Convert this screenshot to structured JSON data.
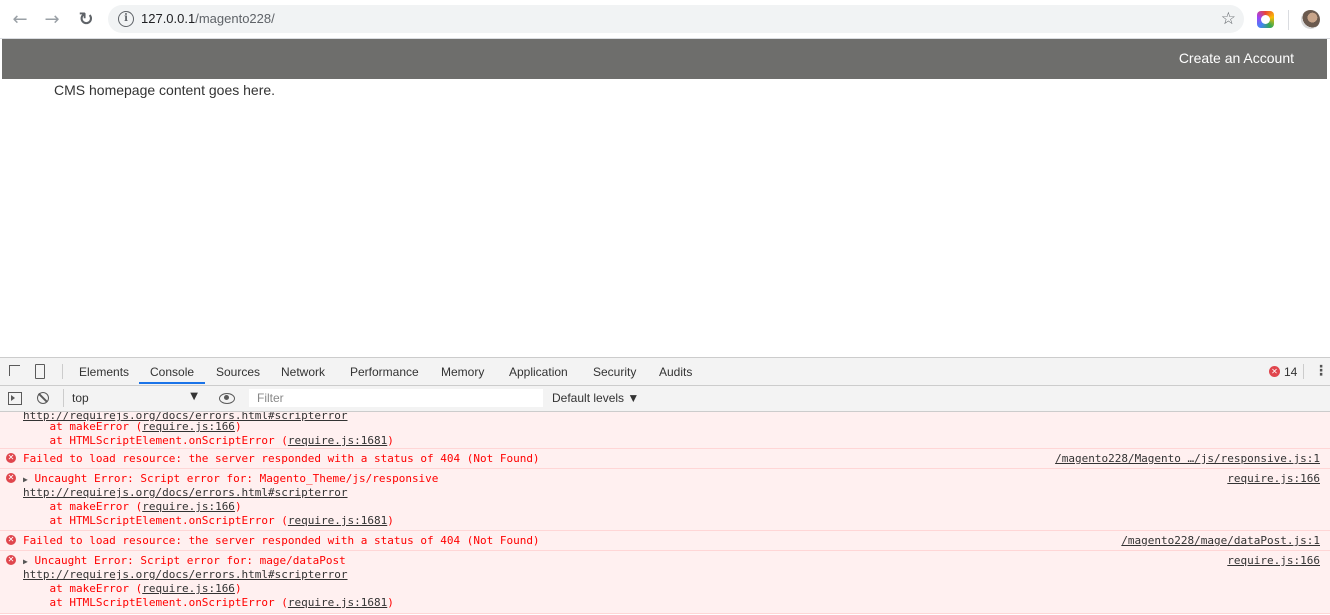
{
  "browser": {
    "url_host": "127.0.0.1",
    "url_path": "/magento228/",
    "back_glyph": "←",
    "forward_glyph": "→",
    "reload_glyph": "↻",
    "info_glyph": "i",
    "star_glyph": "☆"
  },
  "page": {
    "header_link": "Create an Account",
    "content": "CMS homepage content goes here."
  },
  "devtools": {
    "tabs": [
      "Elements",
      "Console",
      "Sources",
      "Network",
      "Performance",
      "Memory",
      "Application",
      "Security",
      "Audits"
    ],
    "active_tab": "Console",
    "error_count": "14",
    "kebab_glyph": "⋮",
    "context_value": "top",
    "caret_glyph": "▼",
    "filter_placeholder": "Filter",
    "levels_label": "Default levels ▼",
    "messages": [
      {
        "lines": [
          "http://requirejs.org/docs/errors.html#scripterror",
          "    at makeError (",
          "require.js:166",
          ")",
          "    at HTMLScriptElement.onScriptError (",
          "require.js:1681",
          ")"
        ]
      }
    ],
    "console": {
      "top_fragment_link": "http://requirejs.org/docs/errors.html#scripterror",
      "at": "    at ",
      "make_error": "makeError (",
      "script_error": "HTMLScriptElement.onScriptError (",
      "close_paren": ")",
      "require_166": "require.js:166",
      "require_1681": "require.js:1681",
      "fail_text": "Failed to load resource: the server responded with a status of 404 (Not Found)",
      "fail1_src": "/magento228/Magento …/js/responsive.js:1",
      "uncaught1": "Uncaught Error: Script error for: Magento_Theme/js/responsive",
      "uncaught1_src": "require.js:166",
      "scripterror_link": "http://requirejs.org/docs/errors.html#scripterror",
      "fail2_src": "/magento228/mage/dataPost.js:1",
      "uncaught2": "Uncaught Error: Script error for: mage/dataPost",
      "uncaught2_src": "require.js:166",
      "error_glyph": "✕",
      "expand_glyph": "▶"
    }
  }
}
